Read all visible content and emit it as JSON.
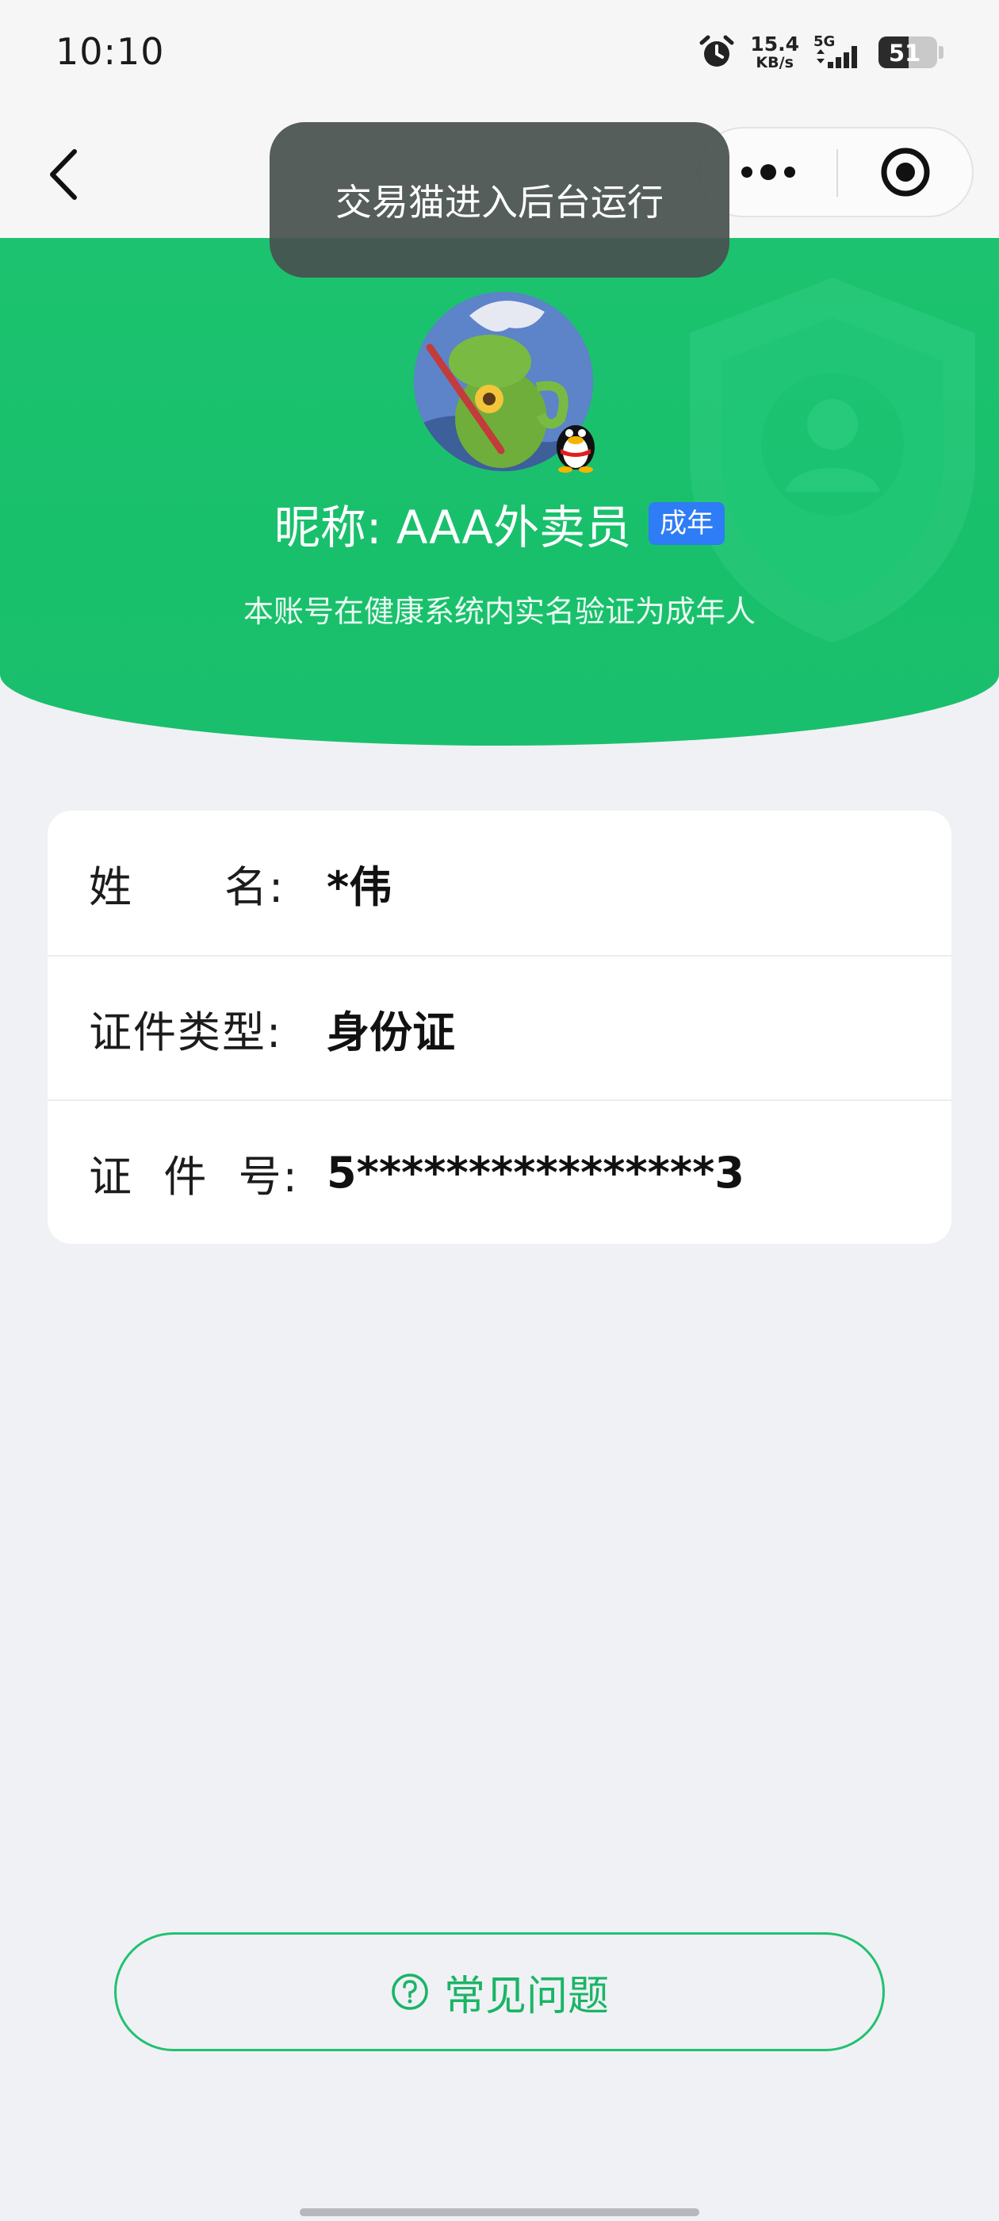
{
  "status_bar": {
    "time": "10:10",
    "net_speed_value": "15.4",
    "net_speed_unit": "KB/s",
    "network_type": "5G",
    "battery_level": "51"
  },
  "toast": {
    "message": "交易猫进入后台运行"
  },
  "profile": {
    "nickname": "昵称: AAA外卖员",
    "age_badge": "成年",
    "verify_text": "本账号在健康系统内实名验证为成年人"
  },
  "info": {
    "rows": [
      {
        "label": "姓      名:",
        "value": "*伟"
      },
      {
        "label": "证件类型:",
        "value": "身份证"
      },
      {
        "label": "证  件  号:",
        "value": "5****************3"
      }
    ]
  },
  "faq": {
    "label": "常见问题"
  },
  "colors": {
    "brand_green": "#1cc26f",
    "badge_blue": "#2e7cf6",
    "faq_green": "#19b566"
  },
  "icons": [
    "back-icon",
    "more-icon",
    "close-target-icon",
    "alarm-icon",
    "signal-icon",
    "battery-icon",
    "qq-icon",
    "shield-icon",
    "question-icon"
  ]
}
